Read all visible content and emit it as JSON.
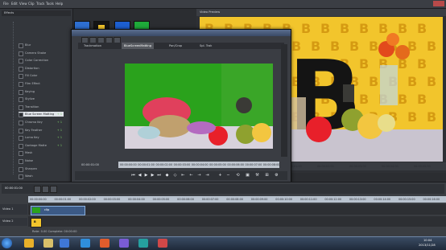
{
  "menubar": {
    "items": [
      "File",
      "Edit",
      "View",
      "Clip",
      "Track",
      "Tools",
      "Help"
    ]
  },
  "left_panel": {
    "header": "Effects",
    "effects": [
      {
        "label": "Blur"
      },
      {
        "label": "Camera Shake"
      },
      {
        "label": "Color Correction"
      },
      {
        "label": "Distortion"
      },
      {
        "label": "Fill Color"
      },
      {
        "label": "Film Effect"
      },
      {
        "label": "Keying"
      },
      {
        "label": "Stylize"
      },
      {
        "label": "Transition"
      },
      {
        "label": "Blue Screen Matting",
        "count": "+ 1",
        "selected": true
      },
      {
        "label": "Chroma Key",
        "count": "+ 1"
      },
      {
        "label": "Key Feather",
        "count": "+ 1"
      },
      {
        "label": "Luma Key",
        "count": "+ 1"
      },
      {
        "label": "Garbage Matte",
        "count": "+ 1"
      },
      {
        "label": "Mask"
      },
      {
        "label": "Noise"
      },
      {
        "label": "Sharpen"
      },
      {
        "label": "Wash"
      }
    ]
  },
  "fx_window": {
    "tabs": [
      "Trackmotion",
      "BlueScreenMatting",
      "Pan/Crop",
      "Spl. Trak"
    ],
    "active_tab": 1,
    "timecode": "00:00:01:00",
    "ruler_labels": [
      "00:00:00:00",
      "00:00:01:00",
      "00:00:02:00",
      "00:00:03:00",
      "00:00:04:00",
      "00:00:05:00",
      "00:00:06:00",
      "00:00:07:00",
      "00:00:08:00"
    ]
  },
  "preview": {
    "tab_title": "Video Preview",
    "timebar_labels": [
      "00:00:00:00",
      "00:00:01:00",
      "00:00:02:00",
      "00:00:03:00",
      "00:00:04:00",
      "00:00:05:00"
    ]
  },
  "timeline": {
    "timecode": "00:00:01:00",
    "ruler_labels": [
      "00:00:00:00",
      "00:00:01:00",
      "00:00:02:00",
      "00:00:03:00",
      "00:00:04:00",
      "00:00:05:00",
      "00:00:06:00",
      "00:00:07:00",
      "00:00:08:00",
      "00:00:09:00",
      "00:00:10:00",
      "00:00:11:00",
      "00:00:12:00",
      "00:00:13:00",
      "00:00:14:00",
      "00:00:15:00",
      "00:00:16:00"
    ],
    "track1_label": "Video 1",
    "track2_label": "Video 2",
    "clip_label": "clip",
    "status_text": "Rate: 0.00   Complete: 00:00:00"
  },
  "taskbar": {
    "clock_time": "10:04",
    "clock_date": "2013/11/28"
  },
  "colors": {
    "accent": "#5a6e8f",
    "selected_row": "#dfe3e8",
    "count_green": "#7fd36a",
    "green_screen": "#2aa21c",
    "yellow_bg": "#f2c52c"
  }
}
